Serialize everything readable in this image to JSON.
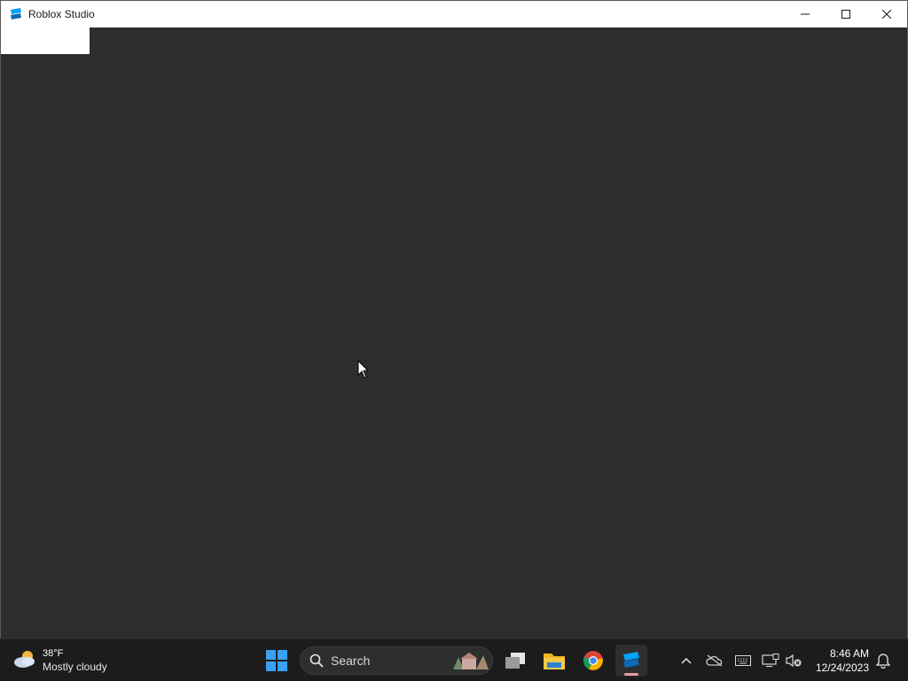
{
  "window": {
    "title": "Roblox Studio",
    "app_icon": "roblox-studio-icon",
    "controls": [
      "minimize-icon",
      "maximize-icon",
      "close-icon"
    ],
    "background": "#2d2d2d"
  },
  "taskbar": {
    "weather": {
      "temperature": "38°F",
      "condition": "Mostly cloudy",
      "icon": "partly-cloudy-icon"
    },
    "search": {
      "label": "Search"
    },
    "apps": [
      "start-icon",
      "task-view-icon",
      "file-explorer-icon",
      "chrome-icon",
      "roblox-studio-icon"
    ],
    "tray": [
      "chevron-up-icon",
      "onedrive-off-icon",
      "keyboard-icon",
      "display-icon",
      "speaker-muted-icon",
      "notification-bell-icon"
    ],
    "clock": {
      "time": "8:46 AM",
      "date": "12/24/2023"
    }
  }
}
